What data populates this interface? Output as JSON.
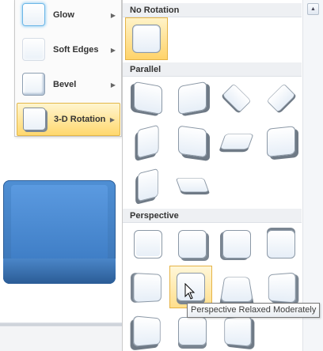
{
  "effects_menu": {
    "items": [
      {
        "label": "Glow",
        "icon": "glow-thumbnail"
      },
      {
        "label": "Soft Edges",
        "icon": "soft-edges-thumbnail"
      },
      {
        "label": "Bevel",
        "icon": "bevel-thumbnail"
      },
      {
        "label": "3-D Rotation",
        "icon": "3d-rotation-thumbnail",
        "active": true
      }
    ],
    "submenu_arrow": "▶"
  },
  "gallery": {
    "sections": [
      {
        "title": "No Rotation",
        "count": 1
      },
      {
        "title": "Parallel",
        "count": 10
      },
      {
        "title": "Perspective",
        "count": 11
      }
    ],
    "scroll_up_glyph": "▲"
  },
  "tooltip": {
    "text": "Perspective Relaxed Moderately"
  },
  "colors": {
    "accent_highlight": "#ffd86e",
    "shape_blue": "#4f8fd4"
  }
}
